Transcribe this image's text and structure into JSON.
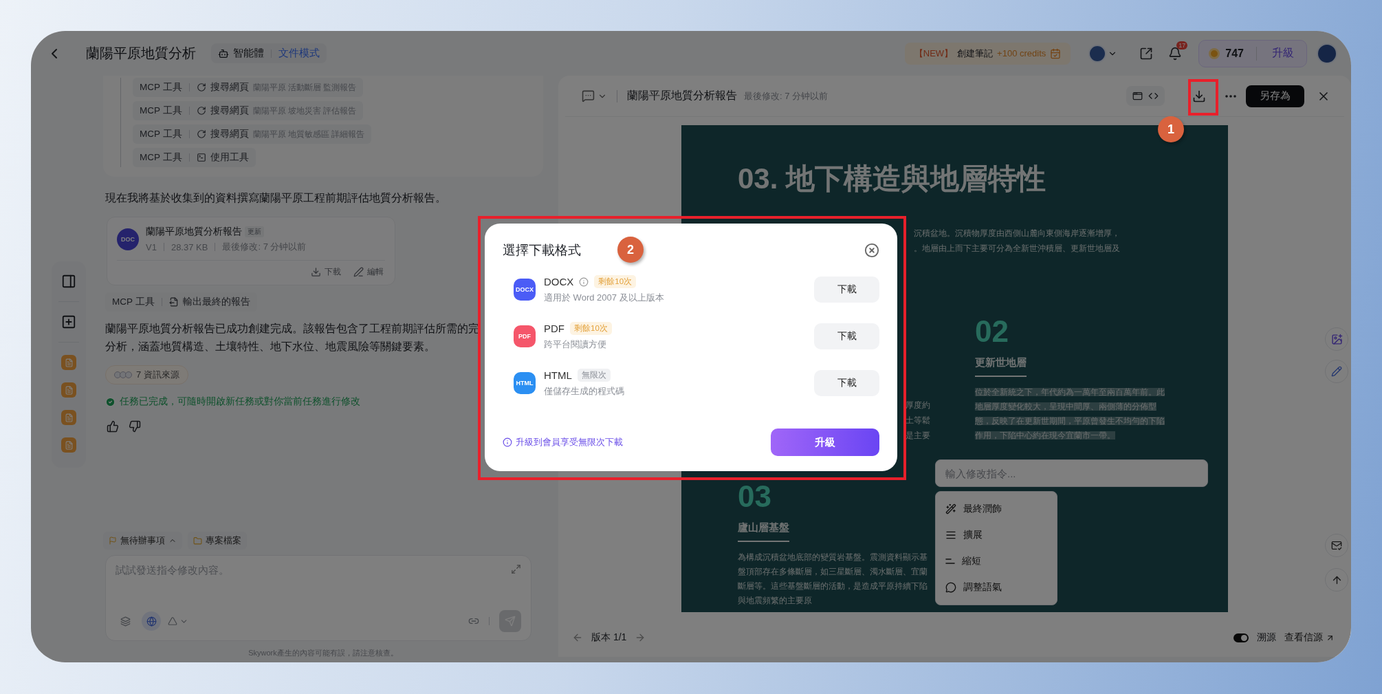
{
  "top_bar": {
    "title": "蘭陽平原地質分析",
    "agent_label": "智能體",
    "mode_label": "文件模式",
    "promo": {
      "tag": "【NEW】",
      "label": "創建筆記",
      "credits": "+100 credits"
    },
    "notification_count": "17",
    "credits": "747",
    "upgrade": "升級"
  },
  "chat": {
    "tool_calls": [
      {
        "tool": "MCP 工具",
        "kind": "search",
        "action": "搜尋網頁",
        "query": "蘭陽平原 活動斷層 監測報告"
      },
      {
        "tool": "MCP 工具",
        "kind": "search",
        "action": "搜尋網頁",
        "query": "蘭陽平原 坡地災害 評估報告"
      },
      {
        "tool": "MCP 工具",
        "kind": "search",
        "action": "搜尋網頁",
        "query": "蘭陽平原 地質敏感區 詳細報告"
      },
      {
        "tool": "MCP 工具",
        "kind": "use",
        "action": "使用工具"
      }
    ],
    "intro": "現在我將基於收集到的資料撰寫蘭陽平原工程前期評估地質分析報告。",
    "doc_card": {
      "icon": "DOC",
      "title": "蘭陽平原地質分析報告",
      "tag": "更新",
      "version": "V1",
      "size": "28.37 KB",
      "modified": "最後修改: 7 分钟以前",
      "actions": [
        "下載",
        "編輯"
      ]
    },
    "final_tool": {
      "tool": "MCP 工具",
      "kind": "output",
      "action": "輸出最終的報告"
    },
    "summary_lines": [
      "蘭陽平原地質分析報告已成功創建完成。該報告包含了工程前期評估所需的完",
      "分析，涵蓋地質構造、土壤特性、地下水位、地震風險等關鍵要素。"
    ],
    "sources": "7 資訊來源",
    "status": "任務已完成，可隨時開啟新任務或對你當前任務進行修改",
    "tabs": [
      {
        "label": "無待辦事項",
        "kind": "todo"
      },
      {
        "label": "專案檔案",
        "kind": "files"
      }
    ],
    "input": {
      "placeholder": "試試發送指令修改內容。"
    },
    "footer": "Skywork產生的內容可能有誤，請注意核查。"
  },
  "document": {
    "title": "蘭陽平原地質分析報告",
    "modified": "最後修改: 7 分钟以前",
    "save_as": "另存為",
    "page": {
      "title": "03. 地下構造與地層特性",
      "intro_lines": [
        "沉積盆地。沉積物厚度由西側山麓向東側海岸逐漸增厚，",
        "。地層由上而下主要可分為全新世沖積層、更新世地層及"
      ],
      "column_1_fragments": [
        "厚度約",
        "土等鬆",
        "是主要"
      ],
      "sections": [
        {
          "number": "02",
          "heading": "更新世地層",
          "body": "位於全新統之下，年代約為一萬年至兩百萬年前。此地層厚度變化較大，呈現中間厚、兩側薄的分佈型態，反映了在更新世期間，平原曾發生不均勻的下陷作用，下陷中心約在現今宜蘭市一帶。",
          "highlighted": true
        },
        {
          "number": "03",
          "heading": "廬山層基盤",
          "body": "為構成沉積盆地底部的變質岩基盤。震測資料顯示基盤頂部存在多條斷層，如三星斷層、濁水斷層、宜蘭斷層等。這些基盤斷層的活動，是造成平原持續下陷與地震頻繁的主要原",
          "highlighted": false
        }
      ]
    },
    "edit_prompt": {
      "placeholder": "輸入修改指令..."
    },
    "edit_menu": [
      {
        "label": "最終潤飾",
        "kind": "polish"
      },
      {
        "label": "擴展",
        "kind": "expand"
      },
      {
        "label": "縮短",
        "kind": "shorten"
      },
      {
        "label": "調整語氣",
        "kind": "tone"
      }
    ],
    "version": "版本 1/1",
    "trace_toggle": {
      "label": "溯源",
      "on": true
    },
    "view_sources": "查看信源"
  },
  "dialog": {
    "title": "選擇下載格式",
    "formats": [
      {
        "icon": "DOCX",
        "color": "#4b5cf6",
        "name": "DOCX",
        "info": true,
        "kind": "limited",
        "quota": "剩餘10次",
        "description": "適用於 Word 2007 及以上版本",
        "button": "下載"
      },
      {
        "icon": "PDF",
        "color": "#f5566a",
        "name": "PDF",
        "info": false,
        "kind": "limited",
        "quota": "剩餘10次",
        "description": "跨平台閱讀方便",
        "button": "下載"
      },
      {
        "icon": "HTML",
        "color": "#2b8ff2",
        "name": "HTML",
        "info": false,
        "kind": "unlimited",
        "quota": "無限次",
        "description": "僅儲存生成的程式碼",
        "button": "下載"
      }
    ],
    "upgrade_note": "升級到會員享受無限次下載",
    "upgrade_button": "升級"
  },
  "annotations": [
    {
      "label": "1"
    },
    {
      "label": "2"
    }
  ]
}
